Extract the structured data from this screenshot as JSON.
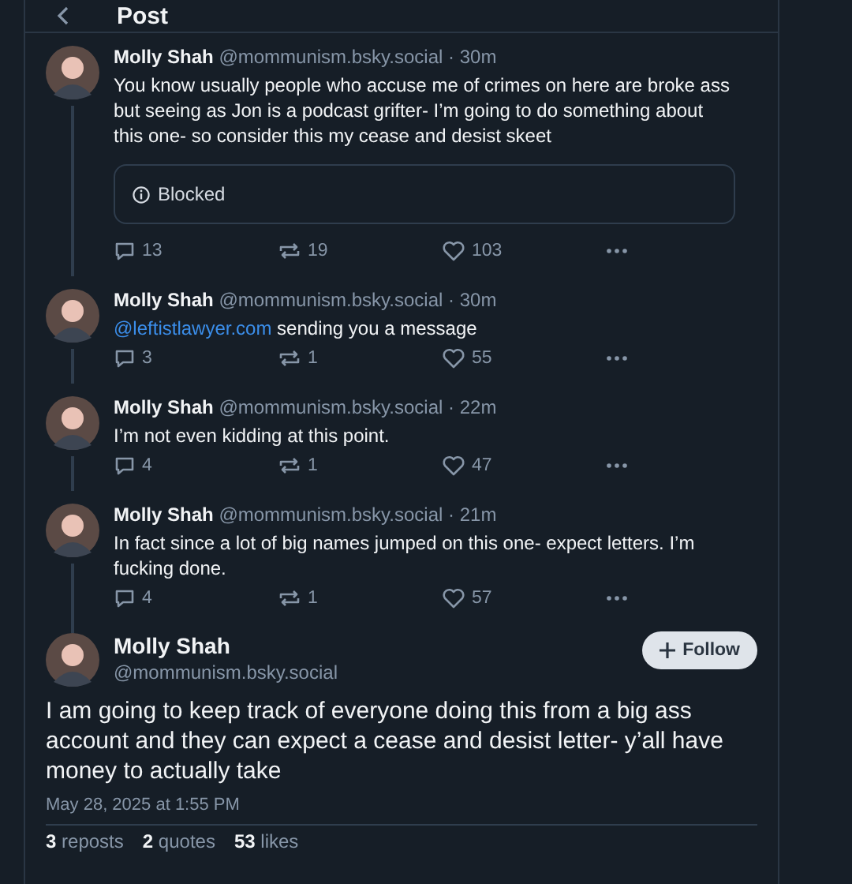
{
  "header": {
    "title": "Post"
  },
  "thread": [
    {
      "name": "Molly Shah",
      "handle": "@mommunism.bsky.social",
      "time": "· 30m",
      "text": "You know usually people who accuse me of crimes on here are broke ass but seeing as Jon is a podcast grifter- I’m going to do something about this one- so consider this my cease and desist skeet",
      "embed": {
        "label": "Blocked"
      },
      "replies": "13",
      "reposts": "19",
      "likes": "103"
    },
    {
      "name": "Molly Shah",
      "handle": "@mommunism.bsky.social",
      "time": "· 30m",
      "mention": "@leftistlawyer.com",
      "text": "sending you a message",
      "replies": "3",
      "reposts": "1",
      "likes": "55"
    },
    {
      "name": "Molly Shah",
      "handle": "@mommunism.bsky.social",
      "time": "· 22m",
      "text": "I’m not even kidding at this point.",
      "replies": "4",
      "reposts": "1",
      "likes": "47"
    },
    {
      "name": "Molly Shah",
      "handle": "@mommunism.bsky.social",
      "time": "· 21m",
      "text": "In fact since a lot of big names jumped on this one- expect letters. I’m fucking done.",
      "replies": "4",
      "reposts": "1",
      "likes": "57"
    }
  ],
  "main_post": {
    "name": "Molly Shah",
    "handle": "@mommunism.bsky.social",
    "follow_button": "Follow",
    "text": "I am going to keep track of everyone doing this from a big ass account and they can expect a cease and desist letter- y’all have money to actually take",
    "timestamp": "May 28, 2025 at 1:55 PM",
    "stats": [
      {
        "count": "3",
        "label": "reposts"
      },
      {
        "count": "2",
        "label": "quotes"
      },
      {
        "count": "53",
        "label": "likes"
      }
    ]
  }
}
